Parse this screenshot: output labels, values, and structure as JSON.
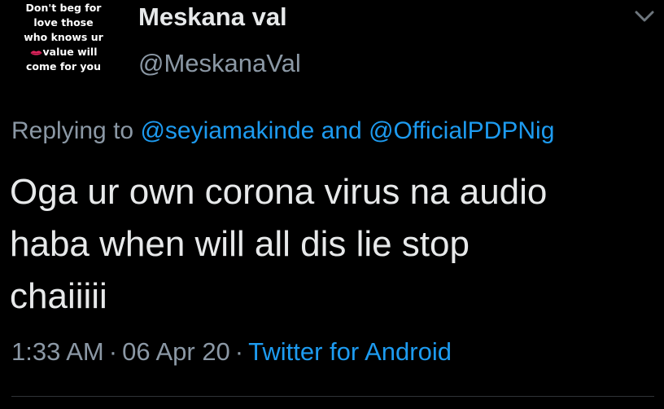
{
  "colors": {
    "background": "#000000",
    "text": "#e7e9ea",
    "secondary": "#8b98a5",
    "accent": "#1d9bf0",
    "divider": "#2f3336"
  },
  "author": {
    "avatar_lines": [
      "Don't beg for",
      "love those",
      "who knows ur",
      "value will",
      "come for you"
    ],
    "avatar_icon": "lips-emoji-icon",
    "display_name": "Meskana val",
    "handle": "@MeskanaVal"
  },
  "menu": {
    "icon": "chevron-down-icon"
  },
  "reply": {
    "prefix": "Replying to",
    "mention_1": "@seyiamakinde",
    "conjunction": "and",
    "mention_2": "@OfficialPDPNig"
  },
  "tweet": {
    "lines": [
      "Oga ur own corona virus na audio",
      "haba when will all dis lie stop",
      "chaiiiii"
    ]
  },
  "meta": {
    "time": "1:33 AM",
    "separator": "·",
    "date": "06 Apr 20",
    "client": "Twitter for Android"
  }
}
